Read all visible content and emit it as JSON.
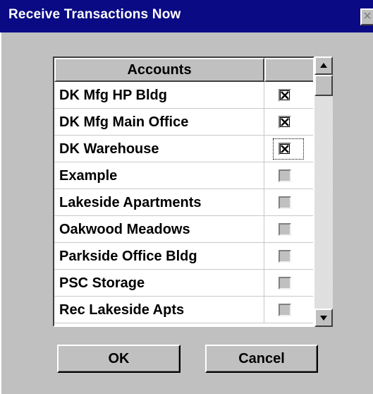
{
  "window": {
    "title": "Receive Transactions Now",
    "close_label": "×"
  },
  "table": {
    "columns": [
      "Accounts",
      ""
    ],
    "rows": [
      {
        "name": "DK Mfg HP Bldg",
        "checked": true
      },
      {
        "name": "DK Mfg Main Office",
        "checked": true
      },
      {
        "name": "DK Warehouse",
        "checked": true,
        "focused": true
      },
      {
        "name": "Example",
        "checked": false
      },
      {
        "name": "Lakeside Apartments",
        "checked": false
      },
      {
        "name": "Oakwood Meadows",
        "checked": false
      },
      {
        "name": "Parkside Office Bldg",
        "checked": false
      },
      {
        "name": "PSC Storage",
        "checked": false
      },
      {
        "name": "Rec Lakeside Apts",
        "checked": false
      }
    ]
  },
  "buttons": {
    "ok_label": "OK",
    "cancel_label": "Cancel"
  },
  "icons": {
    "close": "close-icon",
    "scroll_up": "arrow-up-icon",
    "scroll_down": "arrow-down-icon",
    "check": "checkmark-icon"
  }
}
